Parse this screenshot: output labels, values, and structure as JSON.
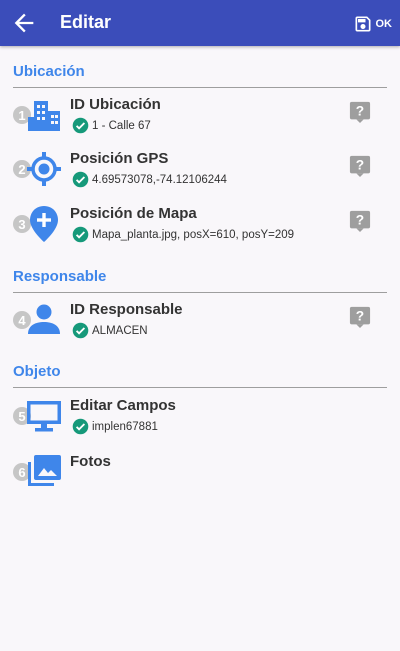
{
  "appbar": {
    "title": "Editar",
    "ok_label": "OK"
  },
  "sections": {
    "ubicacion": "Ubicación",
    "responsable": "Responsable",
    "objeto": "Objeto"
  },
  "rows": [
    {
      "num": "1",
      "title": "ID Ubicación",
      "value": "1 - Calle 67",
      "icon": "building-icon"
    },
    {
      "num": "2",
      "title": "Posición GPS",
      "value": "4.69573078,-74.12106244",
      "icon": "gps-target-icon"
    },
    {
      "num": "3",
      "title": "Posición de Mapa",
      "value": "Mapa_planta.jpg, posX=610, posY=209",
      "icon": "add-location-pin-icon"
    },
    {
      "num": "4",
      "title": "ID Responsable",
      "value": "ALMACEN",
      "icon": "person-icon"
    },
    {
      "num": "5",
      "title": "Editar Campos",
      "value": "implen67881",
      "icon": "monitor-icon"
    },
    {
      "num": "6",
      "title": "Fotos",
      "icon": "photo-library-icon"
    }
  ],
  "colors": {
    "appbar": "#3b4dba",
    "accent": "#3f86ea",
    "check": "#16997a",
    "help": "#9e9e9e"
  }
}
